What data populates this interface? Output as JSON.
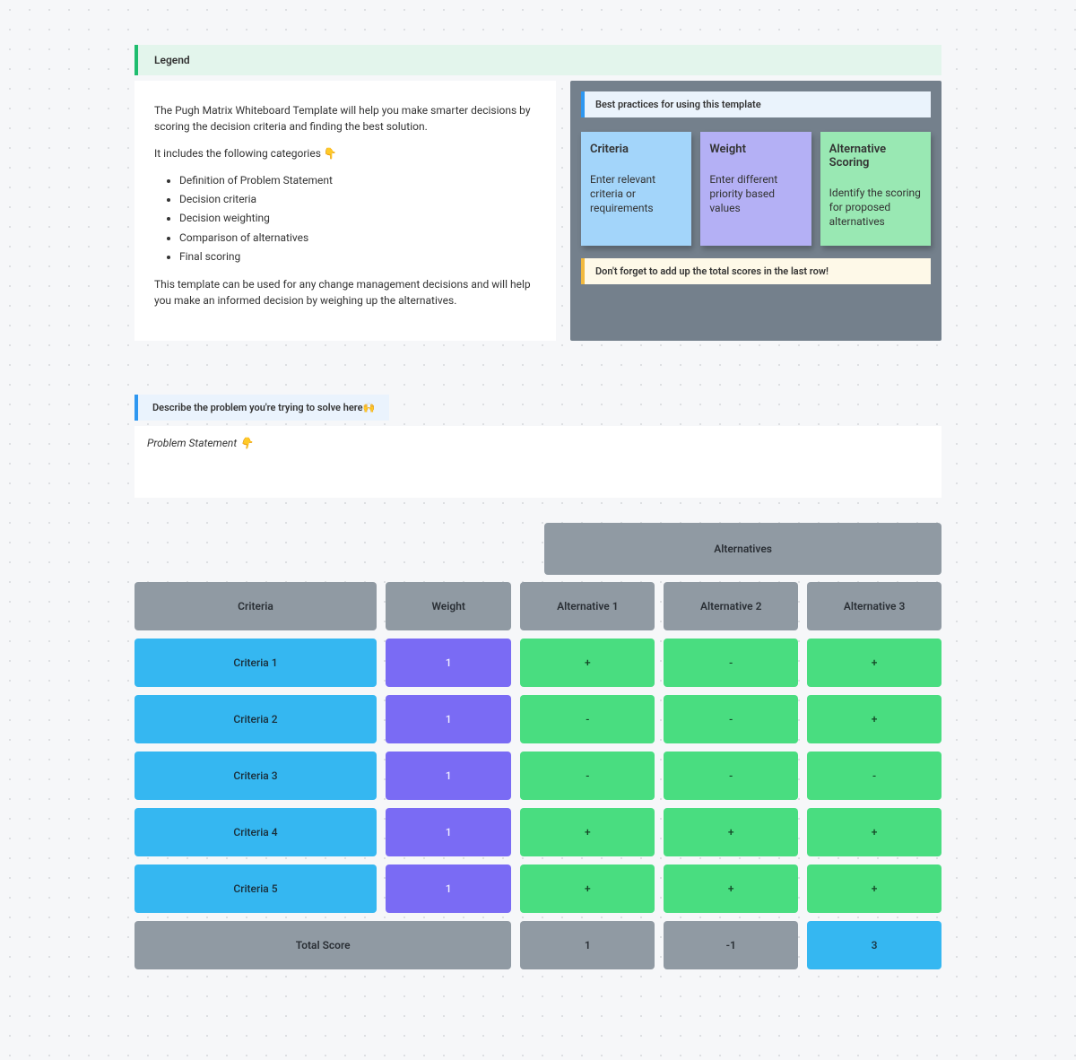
{
  "legend": {
    "title": "Legend"
  },
  "description": {
    "intro": "The Pugh Matrix Whiteboard Template will help you make smarter decisions by scoring the decision criteria and finding the best solution.",
    "includes_lead": "It includes the following categories 👇",
    "items": [
      "Definition of Problem Statement",
      "Decision criteria",
      "Decision weighting",
      "Comparison of alternatives",
      "Final scoring"
    ],
    "outro": "This template can be used for any change management decisions and will help you make an informed decision by weighing up the alternatives."
  },
  "practices": {
    "header": "Best practices for using this template",
    "notes": [
      {
        "title": "Criteria",
        "body": "Enter relevant criteria or requirements"
      },
      {
        "title": "Weight",
        "body": "Enter different priority based values"
      },
      {
        "title": "Alternative Scoring",
        "body": "Identify the scoring for proposed alternatives"
      }
    ],
    "reminder": "Don't forget to add up the total scores in the last row!"
  },
  "problem": {
    "prompt": "Describe the problem you're trying to solve here🙌",
    "label": "Problem Statement  👇"
  },
  "matrix": {
    "alternatives_header": "Alternatives",
    "headers": {
      "criteria": "Criteria",
      "weight": "Weight",
      "alt1": "Alternative 1",
      "alt2": "Alternative 2",
      "alt3": "Alternative 3"
    },
    "rows": [
      {
        "criteria": "Criteria 1",
        "weight": "1",
        "alt1": "+",
        "alt2": "-",
        "alt3": "+"
      },
      {
        "criteria": "Criteria 2",
        "weight": "1",
        "alt1": "-",
        "alt2": "-",
        "alt3": "+"
      },
      {
        "criteria": "Criteria 3",
        "weight": "1",
        "alt1": "-",
        "alt2": "-",
        "alt3": "-"
      },
      {
        "criteria": "Criteria 4",
        "weight": "1",
        "alt1": "+",
        "alt2": "+",
        "alt3": "+"
      },
      {
        "criteria": "Criteria 5",
        "weight": "1",
        "alt1": "+",
        "alt2": "+",
        "alt3": "+"
      }
    ],
    "totals": {
      "label": "Total Score",
      "alt1": "1",
      "alt2": "-1",
      "alt3": "3"
    }
  }
}
